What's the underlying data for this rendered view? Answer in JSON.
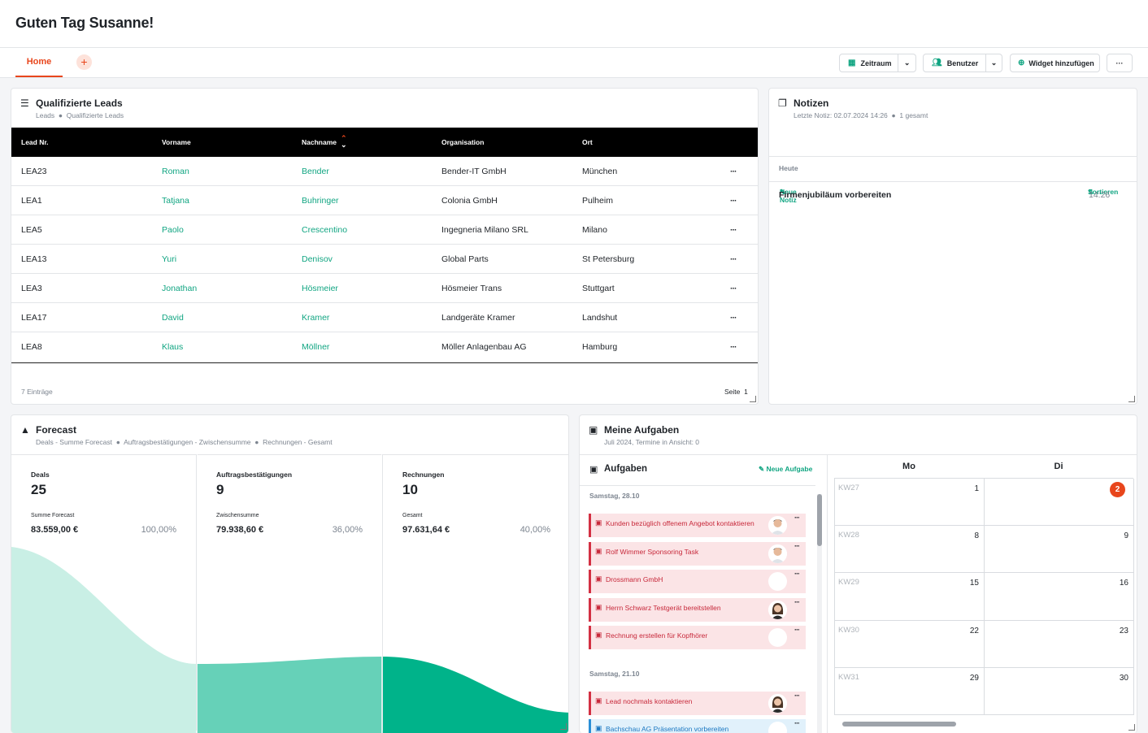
{
  "header": {
    "greeting": "Guten Tag Susanne!"
  },
  "tabs": {
    "home": "Home",
    "add": "+"
  },
  "toolbar": {
    "period": "Zeitraum",
    "users": "Benutzer",
    "add_widget": "Widget hinzufügen",
    "more": "···"
  },
  "leads": {
    "title": "Qualifizierte Leads",
    "crumbs": [
      "Leads",
      "Qualifizierte Leads"
    ],
    "columns": [
      "Lead Nr.",
      "Vorname",
      "Nachname",
      "Organisation",
      "Ort"
    ],
    "rows": [
      [
        "LEA23",
        "Roman",
        "Bender",
        "Bender-IT GmbH",
        "München"
      ],
      [
        "LEA1",
        "Tatjana",
        "Buhringer",
        "Colonia GmbH",
        "Pulheim"
      ],
      [
        "LEA5",
        "Paolo",
        "Crescentino",
        "Ingegneria Milano SRL",
        "Milano"
      ],
      [
        "LEA13",
        "Yuri",
        "Denisov",
        "Global Parts",
        "St Petersburg"
      ],
      [
        "LEA3",
        "Jonathan",
        "Hösmeier",
        "Hösmeier Trans",
        "Stuttgart"
      ],
      [
        "LEA17",
        "David",
        "Kramer",
        "Landgeräte Kramer",
        "Landshut"
      ],
      [
        "LEA8",
        "Klaus",
        "Möllner",
        "Möller Anlagenbau AG",
        "Hamburg"
      ]
    ],
    "row_menu": "···",
    "count": "7 Einträge",
    "page_label": "Seite",
    "page": "1"
  },
  "notes": {
    "title": "Notizen",
    "last_note": "Letzte Notiz: 02.07.2024 14:26",
    "total": "1 gesamt",
    "new_note": "Neue Notiz",
    "sort": "Sortieren",
    "group": "Heute",
    "items": [
      {
        "title": "Firmenjubiläum vorbereiten",
        "time": "14:26"
      }
    ]
  },
  "forecast": {
    "title": "Forecast",
    "crumbs": [
      "Deals - Summe Forecast",
      "Auftragsbestätigungen - Zwischensumme",
      "Rechnungen - Gesamt"
    ],
    "columns": [
      {
        "label": "Deals",
        "count": "25",
        "sub": "Summe Forecast",
        "amount": "83.559,00 €",
        "percent": "100,00%"
      },
      {
        "label": "Auftragsbestätigungen",
        "count": "9",
        "sub": "Zwischensumme",
        "amount": "79.938,60 €",
        "percent": "36,00%"
      },
      {
        "label": "Rechnungen",
        "count": "10",
        "sub": "Gesamt",
        "amount": "97.631,64 €",
        "percent": "40,00%"
      }
    ],
    "colors": [
      "#c9efe5",
      "#66d1b8",
      "#00b38a"
    ]
  },
  "tasks": {
    "title": "Meine Aufgaben",
    "subtitle": "Juli 2024, Termine in Ansicht: 0",
    "list_title": "Aufgaben",
    "new_task": "Neue Aufgabe",
    "groups": [
      {
        "date": "Samstag, 28.10",
        "items": [
          {
            "text": "Kunden bezüglich offenem Angebot kontaktieren",
            "avatar": "man"
          },
          {
            "text": "Rolf Wimmer Sponsoring Task",
            "avatar": "man"
          },
          {
            "text": "Drossmann GmbH",
            "avatar": "none"
          },
          {
            "text": "Herrn Schwarz Testgerät bereitstellen",
            "avatar": "woman"
          },
          {
            "text": "Rechnung erstellen für Kopfhörer",
            "avatar": "none"
          }
        ]
      },
      {
        "date": "Samstag, 21.10",
        "items": [
          {
            "text": "Lead nochmals kontaktieren",
            "avatar": "woman"
          },
          {
            "text": "Bachschau AG Präsentation vorbereiten",
            "avatar": "none",
            "blue": true
          }
        ]
      }
    ],
    "menu": "···"
  },
  "calendar": {
    "days": [
      "Mo",
      "Di"
    ],
    "weeks": [
      {
        "kw": "KW27",
        "mo": "1",
        "di": "2",
        "today": true
      },
      {
        "kw": "KW28",
        "mo": "8",
        "di": "9"
      },
      {
        "kw": "KW29",
        "mo": "15",
        "di": "16"
      },
      {
        "kw": "KW30",
        "mo": "22",
        "di": "23"
      },
      {
        "kw": "KW31",
        "mo": "29",
        "di": "30"
      }
    ]
  }
}
